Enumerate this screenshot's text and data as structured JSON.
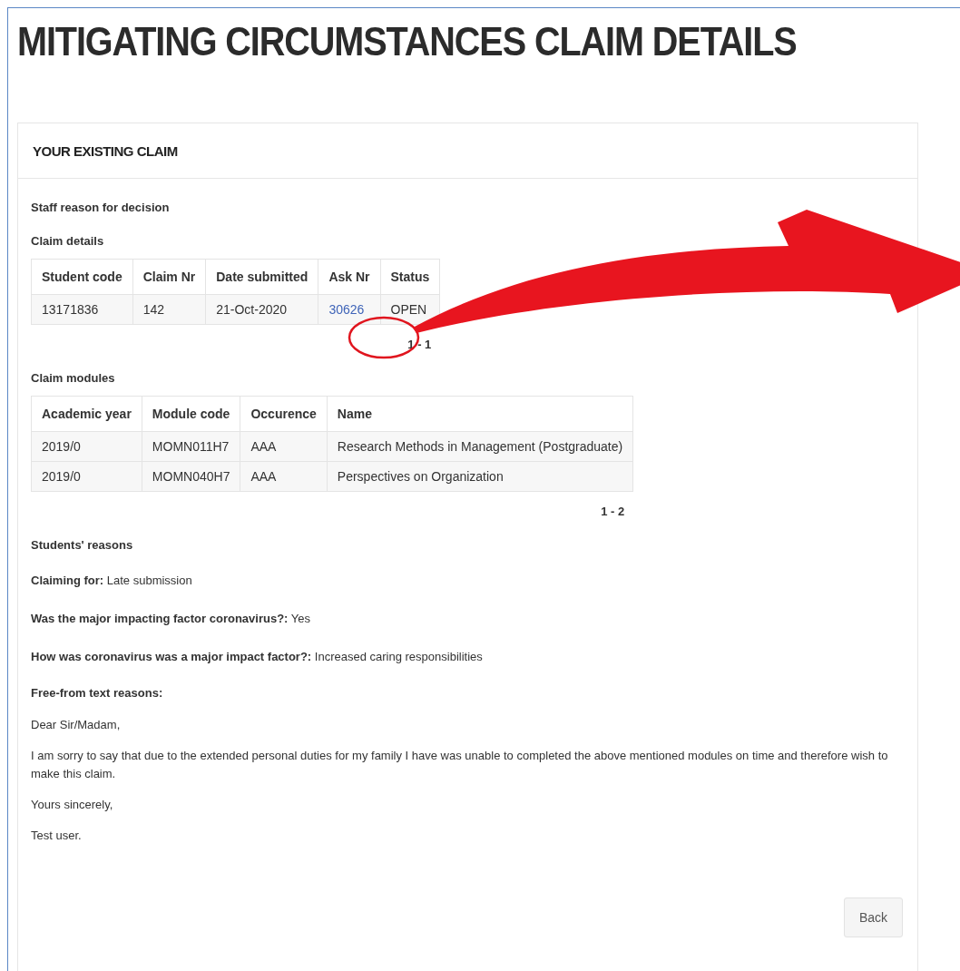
{
  "title": "MITIGATING CIRCUMSTANCES CLAIM DETAILS",
  "panel": {
    "heading": "YOUR EXISTING CLAIM",
    "staff_reason_label": "Staff reason for decision",
    "claim_details": {
      "label": "Claim details",
      "columns": [
        "Student code",
        "Claim Nr",
        "Date submitted",
        "Ask Nr",
        "Status"
      ],
      "rows": [
        {
          "cells": [
            {
              "text": "13171836",
              "kind": "text"
            },
            {
              "text": "142",
              "kind": "text"
            },
            {
              "text": "21-Oct-2020",
              "kind": "text"
            },
            {
              "text": "30626",
              "kind": "link"
            },
            {
              "text": "OPEN",
              "kind": "text"
            }
          ]
        }
      ],
      "pager": "1 - 1"
    },
    "claim_modules": {
      "label": "Claim modules",
      "columns": [
        "Academic year",
        "Module code",
        "Occurence",
        "Name"
      ],
      "rows": [
        {
          "cells": [
            {
              "text": "2019/0",
              "kind": "text"
            },
            {
              "text": "MOMN011H7",
              "kind": "text"
            },
            {
              "text": "AAA",
              "kind": "text"
            },
            {
              "text": "Research Methods in Management (Postgraduate)",
              "kind": "text"
            }
          ]
        },
        {
          "cells": [
            {
              "text": "2019/0",
              "kind": "text"
            },
            {
              "text": "MOMN040H7",
              "kind": "text"
            },
            {
              "text": "AAA",
              "kind": "text"
            },
            {
              "text": "Perspectives on Organization",
              "kind": "text"
            }
          ]
        }
      ],
      "pager": "1 - 2"
    },
    "students_reasons": {
      "label": "Students' reasons",
      "fields": [
        "**Claiming for:** Late submission",
        "**Was the major impacting factor coronavirus?:** Yes",
        "**How was coronavirus was a major impact factor?:** Increased caring responsibilities"
      ],
      "free_text_label": "Free-from text reasons:",
      "letter": [
        "Dear Sir/Madam,",
        "I am sorry to say that due to the extended personal duties for my family I have was unable to completed the above mentioned modules on time and therefore wish to make this claim.",
        "Yours sincerely,",
        "Test user."
      ]
    },
    "back_button": "Back"
  }
}
